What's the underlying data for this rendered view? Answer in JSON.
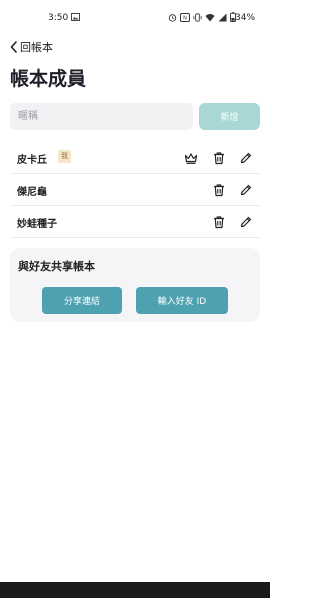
{
  "status_bar": {
    "time": "3:50",
    "battery_percent": "34%",
    "icons": [
      "gallery-icon",
      "alarm-icon",
      "nfc-icon",
      "vibrate-icon",
      "wifi-icon",
      "signal-icon",
      "battery-icon"
    ]
  },
  "nav": {
    "back_label": "回帳本"
  },
  "page": {
    "title": "帳本成員"
  },
  "add_member": {
    "placeholder": "暱稱",
    "value": "",
    "button_label": "新增"
  },
  "members": [
    {
      "name": "皮卡丘",
      "badge": "我",
      "is_owner": true
    },
    {
      "name": "傑尼龜"
    },
    {
      "name": "妙蛙種子"
    }
  ],
  "share": {
    "title": "與好友共享帳本",
    "share_link_label": "分享連結",
    "enter_id_label": "輸入好友 ID"
  },
  "colors": {
    "accent": "#4ea1b1",
    "accent_disabled": "#a9d7d6",
    "badge_bg": "#f4e6c9",
    "badge_text": "#a0713a"
  }
}
